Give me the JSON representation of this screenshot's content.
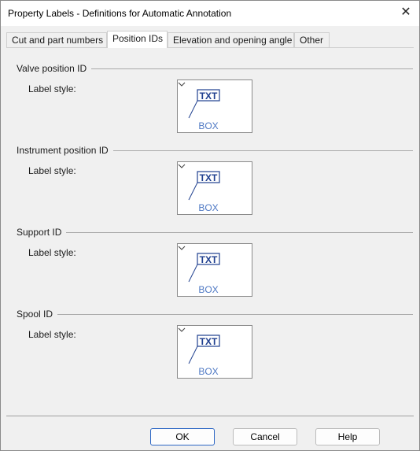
{
  "window": {
    "title": "Property Labels - Definitions for Automatic Annotation"
  },
  "tabs": [
    {
      "label": "Cut and part numbers"
    },
    {
      "label": "Position IDs"
    },
    {
      "label": "Elevation and opening angle"
    },
    {
      "label": "Other"
    }
  ],
  "active_tab": "Position IDs",
  "groups": [
    {
      "title": "Valve position ID",
      "field_label": "Label style:",
      "style": {
        "top": "TXT",
        "bottom": "BOX"
      }
    },
    {
      "title": "Instrument position ID",
      "field_label": "Label style:",
      "style": {
        "top": "TXT",
        "bottom": "BOX"
      }
    },
    {
      "title": "Support ID",
      "field_label": "Label style:",
      "style": {
        "top": "TXT",
        "bottom": "BOX"
      }
    },
    {
      "title": "Spool ID",
      "field_label": "Label style:",
      "style": {
        "top": "TXT",
        "bottom": "BOX"
      }
    }
  ],
  "buttons": {
    "ok": "OK",
    "cancel": "Cancel",
    "help": "Help"
  },
  "colors": {
    "style_text": "#1f3f8f",
    "box_text": "#4f79c4",
    "default_button_border": "#2d67c4"
  }
}
